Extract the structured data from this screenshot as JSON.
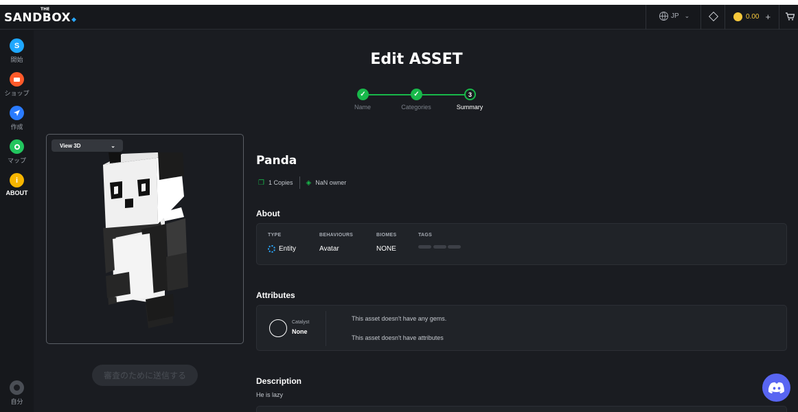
{
  "topbar": {
    "logo_small": "THE",
    "logo_text": "SANDBOX",
    "language": "JP",
    "balance": "0.00",
    "icons": [
      "globe-icon",
      "chevron-down-icon",
      "diamond-icon",
      "sand-coin-icon",
      "plus-icon",
      "cart-icon"
    ]
  },
  "sidebar": {
    "items": [
      {
        "label": "開始",
        "icon": "sandbox-s-icon",
        "glyph": "S",
        "color": "#1ea7ff"
      },
      {
        "label": "ショップ",
        "icon": "shop-icon",
        "glyph": "▬",
        "color": "#ff5a2a"
      },
      {
        "label": "作成",
        "icon": "create-icon",
        "glyph": "◀",
        "color": "#2a7bff"
      },
      {
        "label": "マップ",
        "icon": "map-pin-icon",
        "glyph": "●",
        "color": "#22c55e"
      },
      {
        "label": "ABOUT",
        "icon": "info-icon",
        "glyph": "i",
        "color": "#f7b500"
      }
    ],
    "profile_label": "自分"
  },
  "page": {
    "title": "Edit ASSET",
    "steps": [
      {
        "label": "Name",
        "state": "done",
        "glyph": "✓"
      },
      {
        "label": "Categories",
        "state": "done",
        "glyph": "✓"
      },
      {
        "label": "Summary",
        "state": "current",
        "glyph": "3"
      }
    ]
  },
  "viewer": {
    "view_mode": "View 3D"
  },
  "submit_button": "審査のために送信する",
  "asset": {
    "name": "Panda",
    "copies": "1 Copies",
    "owner": "NaN owner"
  },
  "about": {
    "heading": "About",
    "columns": [
      {
        "header": "TYPE",
        "value": "Entity"
      },
      {
        "header": "BEHAVIOURS",
        "value": "Avatar"
      },
      {
        "header": "BIOMES",
        "value": "NONE"
      },
      {
        "header": "TAGS",
        "value": ""
      }
    ]
  },
  "attributes": {
    "heading": "Attributes",
    "catalyst_label": "Catalyst",
    "catalyst_value": "None",
    "gems_text": "This asset doesn't have any gems.",
    "attributes_text": "This asset doesn't have attributes"
  },
  "description": {
    "heading": "Description",
    "text": "He is lazy"
  },
  "colors": {
    "accent_green": "#18b84a",
    "brand_blue": "#29a8ff",
    "discord": "#5865f2",
    "coin": "#f7c83b"
  }
}
